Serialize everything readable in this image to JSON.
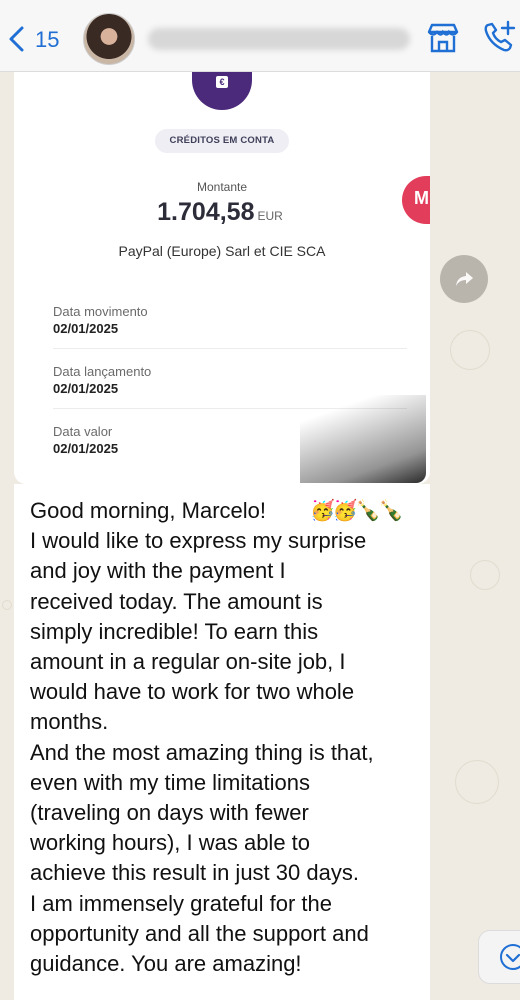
{
  "header": {
    "back_count": "15",
    "contact_name": ""
  },
  "receipt": {
    "badge": "CRÉDITOS EM CONTA",
    "amount_label": "Montante",
    "amount_value": "1.704,58",
    "amount_currency": "EUR",
    "payee": "PayPal (Europe) Sarl et CIE SCA",
    "side_chip_letter": "M",
    "fields": [
      {
        "label": "Data movimento",
        "value": "02/01/2025"
      },
      {
        "label": "Data lançamento",
        "value": "02/01/2025"
      },
      {
        "label": "Data valor",
        "value": "02/01/2025"
      }
    ]
  },
  "message": {
    "text": "Good morning, Marcelo!\nI would like to express my surprise\nand joy with the payment I\nreceived today. The amount is\nsimply incredible! To earn this\namount in a regular on-site job, I\nwould have to work for two whole\nmonths.\nAnd the most amazing thing is that,\neven with my time limitations\n(traveling on days with fewer\nworking hours), I was able to\nachieve this result in just 30 days.\nI am immensely grateful for the\nopportunity and all the support and\nguidance. You are amazing!",
    "emoji": "🥳🥳🍾🍾"
  },
  "colors": {
    "accent_blue": "#1f6fd4",
    "bank_purple": "#4b2a7b",
    "chip_red": "#e23d5a",
    "chat_bg": "#efeae2"
  },
  "icons": [
    "chevron-left-icon",
    "shop-icon",
    "call-add-icon",
    "euro-icon",
    "forward-icon",
    "chevron-down-icon"
  ]
}
